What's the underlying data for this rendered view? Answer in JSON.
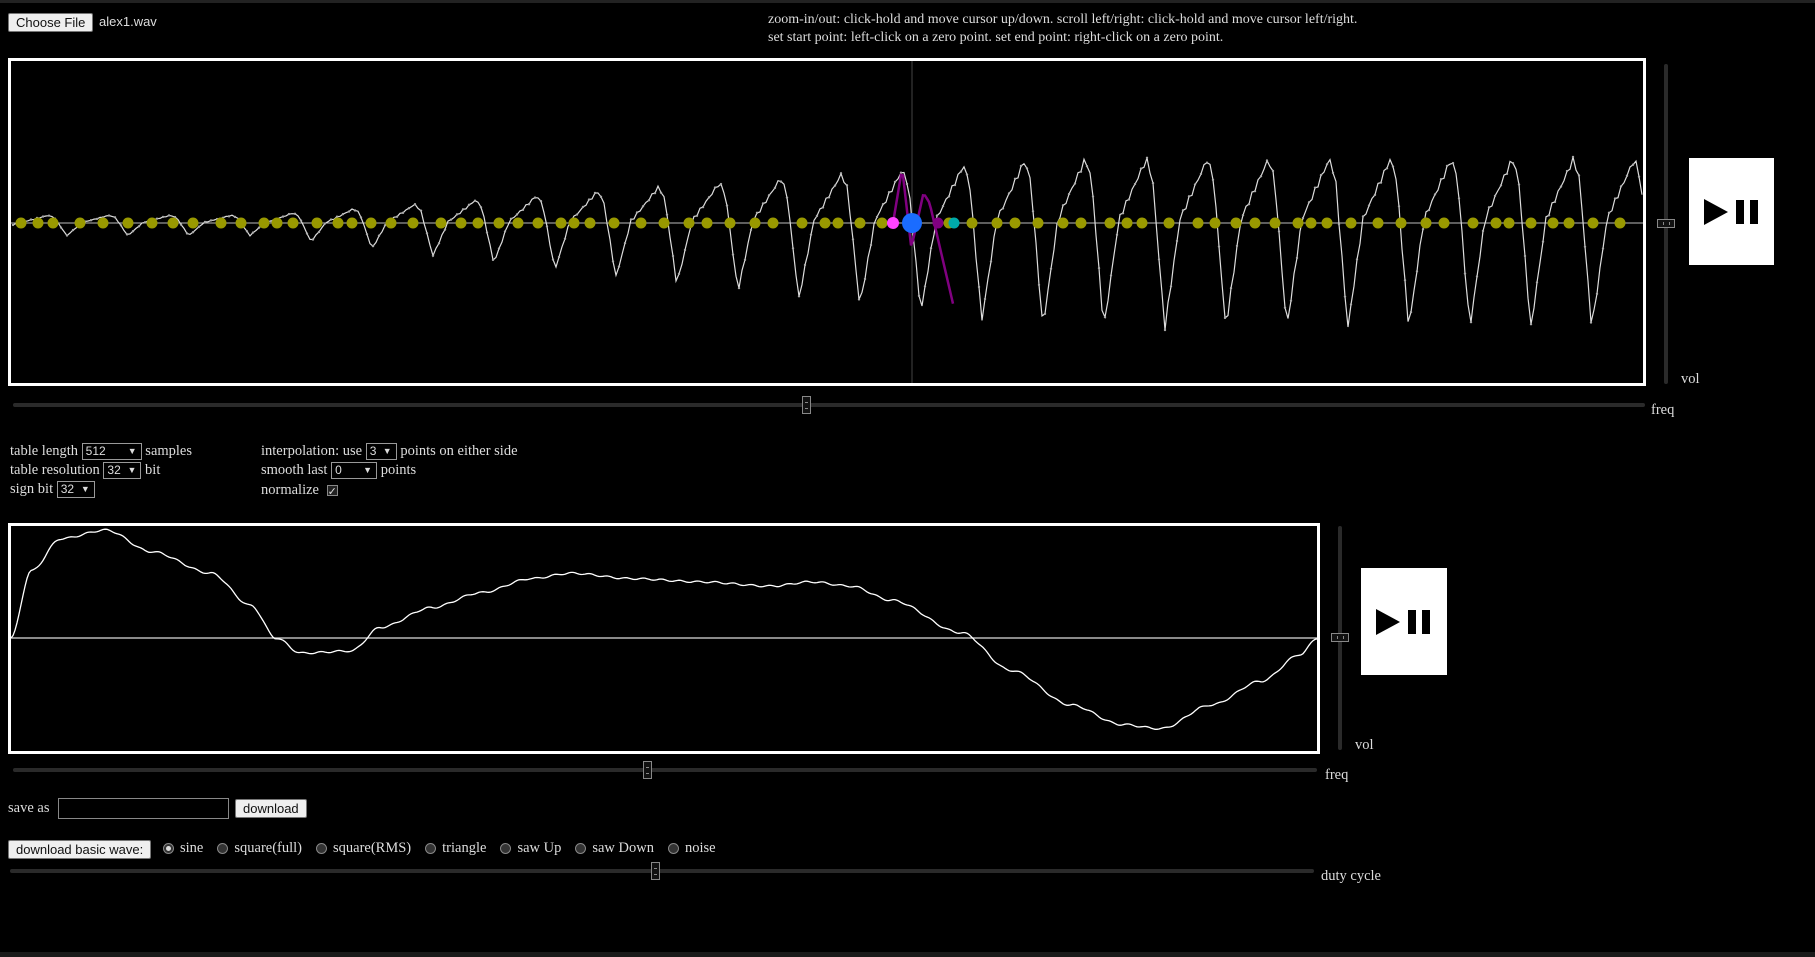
{
  "file": {
    "button_label": "Choose File",
    "filename": "alex1.wav"
  },
  "instructions": {
    "line1": "zoom-in/out: click-hold and move cursor up/down. scroll left/right: click-hold and move cursor left/right.",
    "line2": "set start point: left-click on a zero point. set end point: right-click on a zero point."
  },
  "top_player": {
    "vol_label": "vol",
    "freq_label": "freq",
    "freq_value": 0.49,
    "vol_value": 0.5
  },
  "settings": {
    "table_length_label": "table length",
    "table_length_value": "512",
    "table_length_unit": "samples",
    "table_resolution_label": "table resolution",
    "table_resolution_value": "32",
    "table_resolution_unit": "bit",
    "sign_bit_label": "sign bit",
    "sign_bit_value": "32",
    "interp_prefix": "interpolation: use",
    "interp_value": "3",
    "interp_suffix": "points on either side",
    "smooth_prefix": "smooth last",
    "smooth_value": "0",
    "smooth_suffix": "points",
    "normalize_label": "normalize",
    "normalize_checked": true
  },
  "bottom_player": {
    "vol_label": "vol",
    "freq_label": "freq",
    "freq_value": 0.49,
    "vol_value": 0.5
  },
  "save": {
    "label": "save as",
    "input_value": "",
    "download_label": "download"
  },
  "basic_wave": {
    "button_label": "download basic wave:",
    "options": [
      "sine",
      "square(full)",
      "square(RMS)",
      "triangle",
      "saw Up",
      "saw Down",
      "noise"
    ],
    "selected": "sine",
    "duty_label": "duty cycle",
    "duty_value": 0.5
  },
  "colors": {
    "marker": "#999900",
    "start_marker": "#ff44ff",
    "end_marker": "#00aaaa",
    "cursor_marker": "#1a6cff",
    "selection": "#800080",
    "waveform": "#dddddd"
  }
}
